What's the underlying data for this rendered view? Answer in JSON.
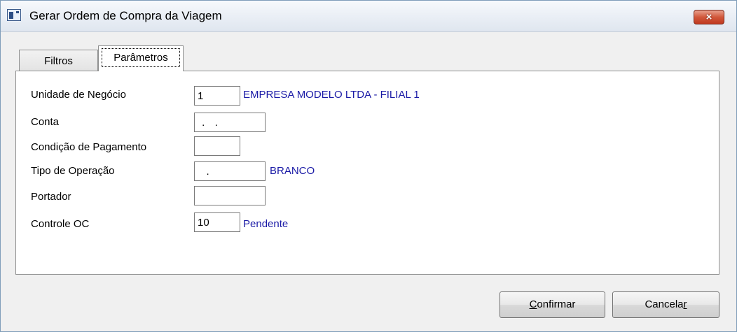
{
  "window": {
    "title": "Gerar Ordem de Compra da Viagem",
    "close_label": "×"
  },
  "tabs": [
    {
      "label": "Filtros"
    },
    {
      "label": "Parâmetros"
    }
  ],
  "form": {
    "unidade_negocio": {
      "label": "Unidade de Negócio",
      "value": "1",
      "description": "EMPRESA MODELO LTDA - FILIAL 1"
    },
    "conta": {
      "label": "Conta",
      "value": " .  ."
    },
    "condicao_pagamento": {
      "label": "Condição de Pagamento",
      "value": ""
    },
    "tipo_operacao": {
      "label": "Tipo de Operação",
      "value": "   .",
      "description": "BRANCO"
    },
    "portador": {
      "label": "Portador",
      "value": ""
    },
    "controle_oc": {
      "label": "Controle OC",
      "value": "10",
      "description": "Pendente"
    }
  },
  "buttons": {
    "confirm": {
      "first": "C",
      "rest": "onfirmar"
    },
    "cancel": {
      "first": "Cancela",
      "underlined": "r"
    }
  }
}
